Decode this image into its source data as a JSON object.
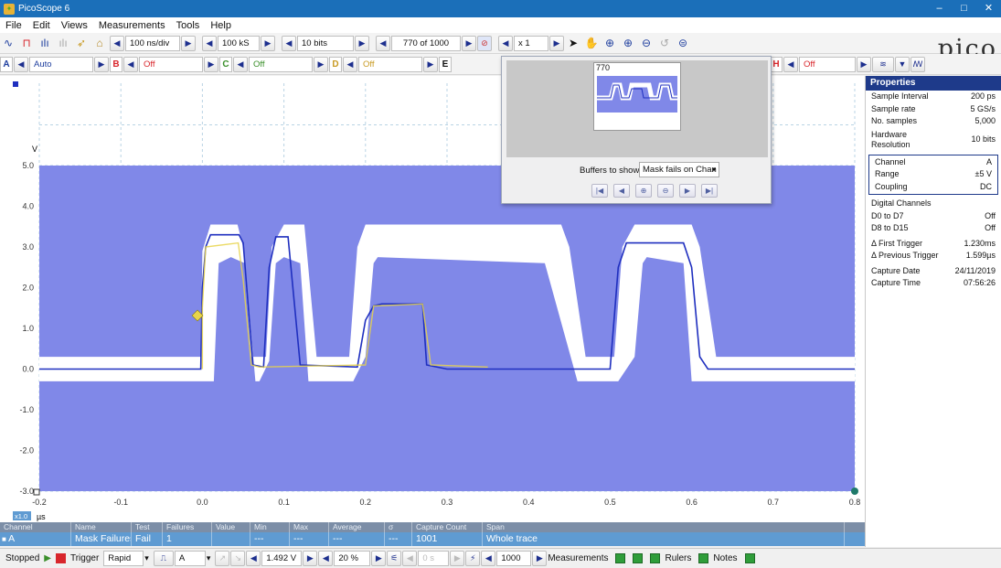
{
  "window": {
    "title": "PicoScope 6",
    "minimize": "–",
    "maximize": "□",
    "close": "✕"
  },
  "menu": [
    {
      "label": "File",
      "key": "F"
    },
    {
      "label": "Edit",
      "key": "E"
    },
    {
      "label": "Views",
      "key": "V"
    },
    {
      "label": "Measurements",
      "key": "M"
    },
    {
      "label": "Tools",
      "key": "T"
    },
    {
      "label": "Help",
      "key": "H"
    }
  ],
  "toolbar": {
    "timebase": "100 ns/div",
    "samples": "100 kS",
    "resolution": "10 bits",
    "buffer_position": "770 of 1000",
    "zoom_factor": "x 1"
  },
  "channels": {
    "A": {
      "label": "A",
      "range": "Auto"
    },
    "B": {
      "label": "B",
      "range": "Off"
    },
    "C": {
      "label": "C",
      "range": "Off"
    },
    "D": {
      "label": "D",
      "range": "Off"
    },
    "E": {
      "label": "E"
    },
    "H": {
      "label": "H",
      "range": "Off"
    }
  },
  "logo": "pico",
  "scope": {
    "y_unit": "V",
    "x_unit": "µs",
    "zoom_badge": "x1.0",
    "y_ticks": [
      "5.0",
      "4.0",
      "3.0",
      "2.0",
      "1.0",
      "0.0",
      "-1.0",
      "-2.0",
      "-3.0"
    ],
    "x_ticks": [
      "-0.2",
      "-0.1",
      "0.0",
      "0.1",
      "0.2",
      "0.3",
      "0.4",
      "0.5",
      "0.6",
      "0.7",
      "0.8"
    ],
    "colors": {
      "mask": "#8088e8",
      "trace_a": "#1f2fbf",
      "highlight": "#e8d44a",
      "grid": "#b9d3e4"
    }
  },
  "buffer_navigator": {
    "thumb_number": "770",
    "buffers_label": "Buffers to show",
    "buffers_value": "Mask fails on Chan"
  },
  "properties": {
    "title": "Properties",
    "rows1": [
      {
        "k": "Sample Interval",
        "v": "200 ps"
      },
      {
        "k": "Sample rate",
        "v": "5 GS/s"
      },
      {
        "k": "No. samples",
        "v": "5,000"
      },
      {
        "k": "Hardware Resolution",
        "v": "10 bits"
      }
    ],
    "channel_box": [
      {
        "k": "Channel",
        "v": "A"
      },
      {
        "k": "Range",
        "v": "±5 V"
      },
      {
        "k": "Coupling",
        "v": "DC"
      }
    ],
    "rows2": [
      {
        "k": "Digital Channels",
        "v": ""
      },
      {
        "k": "D0 to D7",
        "v": "Off"
      },
      {
        "k": "D8 to D15",
        "v": "Off"
      },
      {
        "k": "Δ First Trigger",
        "v": "1.230ms"
      },
      {
        "k": "Δ Previous Trigger",
        "v": "1.599µs"
      },
      {
        "k": "Capture Date",
        "v": "24/11/2019"
      },
      {
        "k": "Capture Time",
        "v": "07:56:26"
      }
    ]
  },
  "measurements": {
    "headers": [
      "Channel",
      "Name",
      "Test",
      "Failures",
      "Value",
      "Min",
      "Max",
      "Average",
      "σ",
      "Capture Count",
      "Span"
    ],
    "rows": [
      [
        "A",
        "Mask Failures",
        "Fail",
        "1",
        "",
        "---",
        "---",
        "---",
        "---",
        "1001",
        "Whole trace"
      ]
    ]
  },
  "statusbar": {
    "state": "Stopped",
    "trigger_label": "Trigger",
    "trigger_mode": "Rapid",
    "trigger_channel": "A",
    "trigger_level": "1.492 V",
    "pretrigger": "20 %",
    "delay": "0 s",
    "captures": "1000",
    "measurements_label": "Measurements",
    "rulers_label": "Rulers",
    "notes_label": "Notes"
  }
}
